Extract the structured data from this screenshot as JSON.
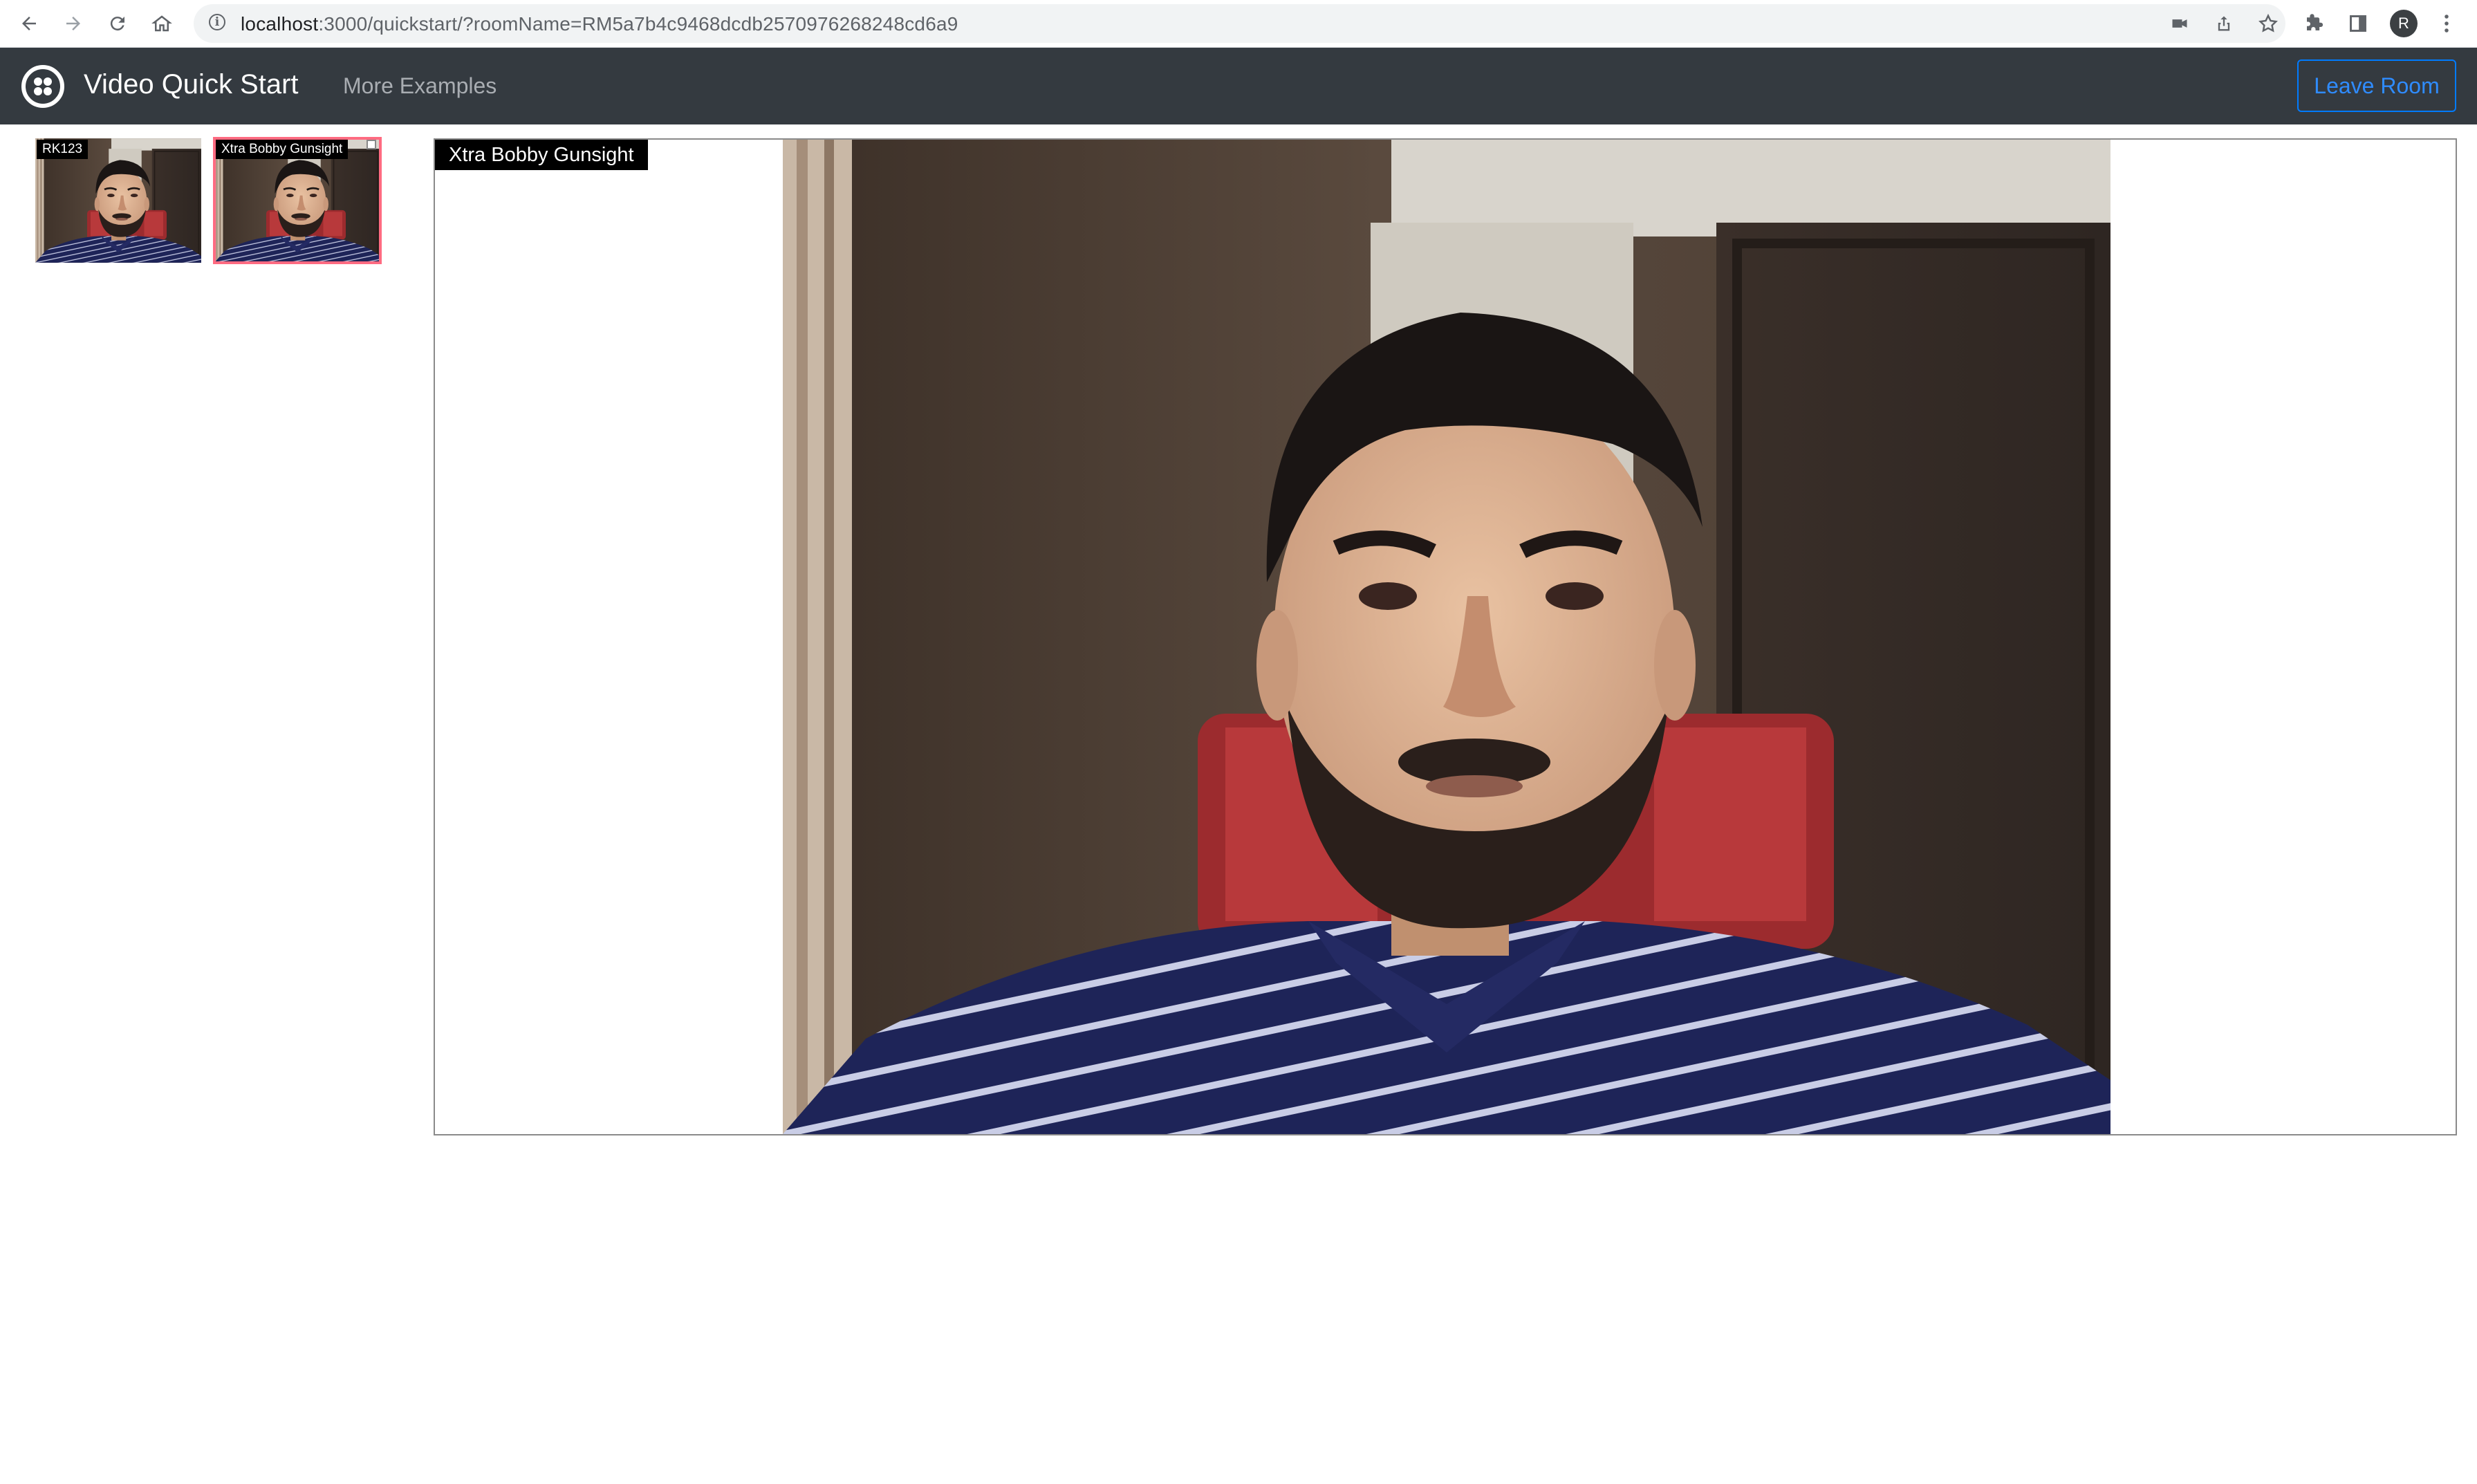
{
  "browser": {
    "url_host": "localhost",
    "url_rest": ":3000/quickstart/?roomName=RM5a7b4c9468dcdb2570976268248cd6a9",
    "profile_initial": "R",
    "icons": [
      "back-arrow-icon",
      "forward-arrow-icon",
      "reload-icon",
      "home-icon",
      "info-icon",
      "camera-icon",
      "share-icon",
      "bookmark-star-icon",
      "extensions-puzzle-icon",
      "side-panel-icon",
      "profile-avatar",
      "kebab-menu-icon"
    ]
  },
  "navbar": {
    "brand": "Video Quick Start",
    "more_examples": "More Examples",
    "leave_button": "Leave Room",
    "logo_icon": "twilio-logo-icon"
  },
  "participants": [
    {
      "name": "RK123",
      "active": false
    },
    {
      "name": "Xtra Bobby Gunsight",
      "active": true
    }
  ],
  "main_video": {
    "participant_name": "Xtra Bobby Gunsight"
  },
  "colors": {
    "navbar_bg": "#343a40",
    "accent_blue": "#007bff",
    "active_outline": "#ff6b81"
  }
}
